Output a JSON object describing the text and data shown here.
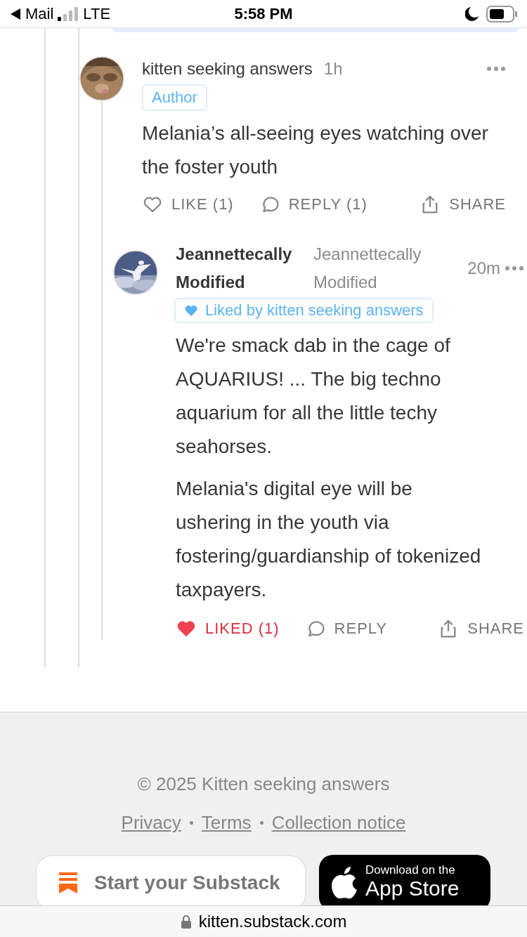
{
  "status_bar": {
    "back_app": "Mail",
    "network": "LTE",
    "time": "5:58 PM"
  },
  "comments": [
    {
      "author": "kitten seeking answers",
      "time": "1h",
      "badge": "Author",
      "body": [
        "Melania’s all-seeing eyes watching over the foster youth"
      ],
      "actions": [
        {
          "kind": "like",
          "label": "LIKE (1)",
          "liked": false
        },
        {
          "kind": "reply",
          "label": "REPLY (1)"
        },
        {
          "kind": "share",
          "label": "SHARE"
        }
      ],
      "replies": [
        {
          "author": "Jeannettecally Modified",
          "handle": "Jeannettecally Modified",
          "time": "20m",
          "liked_by": "Liked by kitten seeking answers",
          "body": [
            "We're smack dab in the cage of AQUARIUS! ... The big techno aquarium for all the little techy seahorses.",
            "Melania's digital eye will be ushering in the youth via fostering/guardianship of tokenized taxpayers."
          ],
          "actions": [
            {
              "kind": "like",
              "label": "LIKED (1)",
              "liked": true
            },
            {
              "kind": "reply",
              "label": "REPLY"
            },
            {
              "kind": "share",
              "label": "SHARE"
            }
          ]
        }
      ]
    }
  ],
  "footer": {
    "copyright": "© 2025 Kitten seeking answers",
    "links": [
      "Privacy",
      "Terms",
      "Collection notice"
    ],
    "start_button": "Start your Substack",
    "store_button": {
      "small": "Download on the",
      "large": "App Store"
    }
  },
  "url_bar": {
    "url": "kitten.substack.com"
  }
}
